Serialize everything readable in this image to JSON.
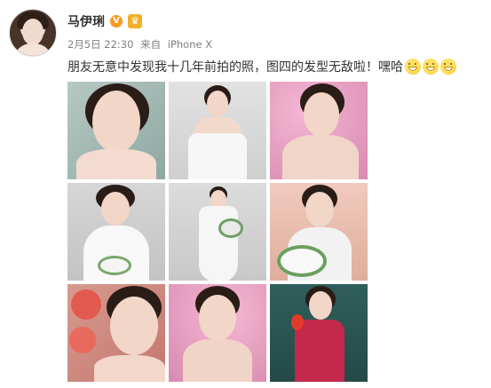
{
  "post": {
    "user_name": "马伊琍",
    "verified_badge": "V",
    "badge_icon": "crown-icon",
    "date": "2月5日 22:30",
    "source_prefix": "来自",
    "device": "iPhone X",
    "text": "朋友无意中发现我十几年前拍的照，图四的发型无敌啦！嘿哈",
    "emoji_icon": "grin-emoji-icon",
    "emoji_count": 3
  },
  "photos": [
    {
      "bg": "#9fb5b0",
      "theme": "portrait"
    },
    {
      "bg": "#d8d8d8",
      "theme": "white-dress"
    },
    {
      "bg": "#e9a2c2",
      "theme": "pink"
    },
    {
      "bg": "#cfcfcf",
      "theme": "puff-sleeves"
    },
    {
      "bg": "#d3d3d3",
      "theme": "full-gown"
    },
    {
      "bg": "#e9c2b3",
      "theme": "bouquet"
    },
    {
      "bg": "#c9928e",
      "theme": "roses"
    },
    {
      "bg": "#e9a6c6",
      "theme": "pink-closeup"
    },
    {
      "bg": "#2c5b58",
      "theme": "red-dress"
    }
  ],
  "colors": {
    "name": "#333333",
    "meta": "#808080",
    "verified": "#f79a1e"
  }
}
